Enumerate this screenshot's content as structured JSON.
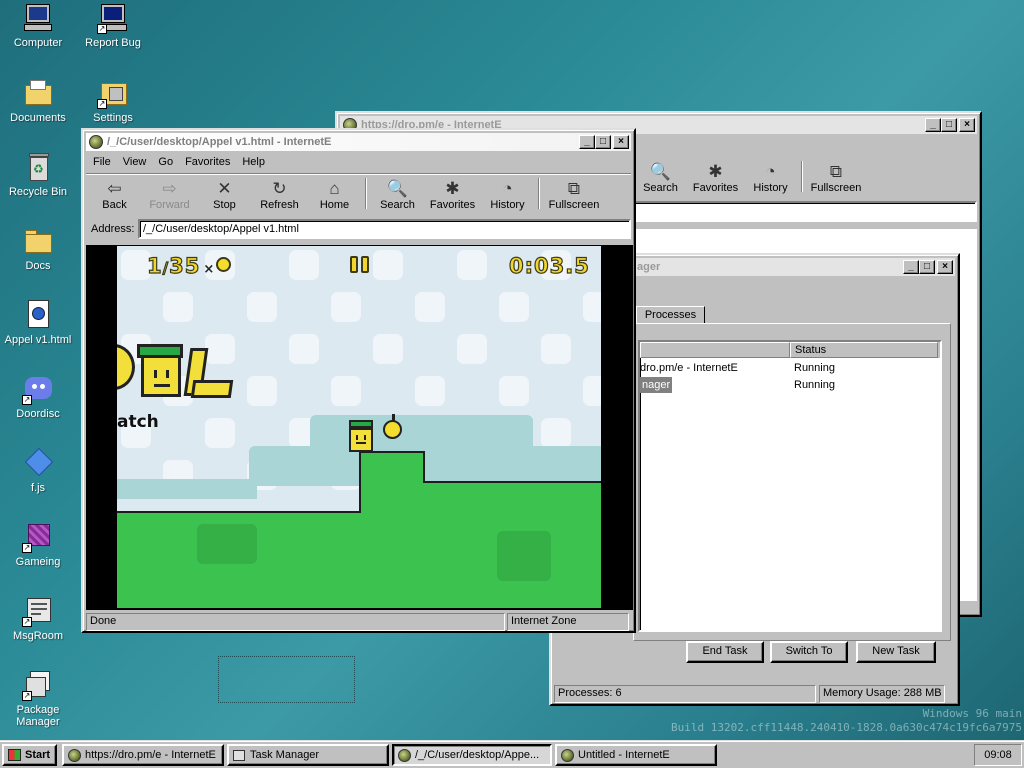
{
  "desktop": {
    "icons": [
      {
        "label": "Computer",
        "icon": "computer-icon"
      },
      {
        "label": "Report Bug",
        "icon": "report-bug-icon"
      },
      {
        "label": "Documents",
        "icon": "documents-folder-icon"
      },
      {
        "label": "Settings",
        "icon": "settings-icon"
      },
      {
        "label": "Recycle Bin",
        "icon": "recycle-bin-icon"
      },
      {
        "label": "Docs",
        "icon": "folder-icon"
      },
      {
        "label": "Appel v1.html",
        "icon": "html-file-icon"
      },
      {
        "label": "Doordisc",
        "icon": "doordisc-icon"
      },
      {
        "label": "f.js",
        "icon": "js-file-icon"
      },
      {
        "label": "Gameing",
        "icon": "gameing-icon"
      },
      {
        "label": "MsgRoom",
        "icon": "msgroom-icon"
      },
      {
        "label": "Package Manager",
        "icon": "package-manager-icon"
      }
    ],
    "watermark": {
      "line1": "Windows 96 main",
      "line2": "Build 13202.cff11448.240410-1828.0a630c474c19fc6a7975"
    }
  },
  "back_browser": {
    "title": "https://dro.pm/e - InternetE",
    "toolbar": [
      {
        "label": "Search",
        "glyph": "🔍"
      },
      {
        "label": "Favorites",
        "glyph": "✱"
      },
      {
        "label": "History",
        "glyph": "◔"
      },
      {
        "label": "Fullscreen",
        "glyph": "⧉"
      }
    ]
  },
  "task_manager": {
    "title_fragment": "ager",
    "tab": "Processes",
    "columns": [
      "",
      "Status"
    ],
    "rows": [
      {
        "name": "dro.pm/e - InternetE",
        "status": "Running"
      },
      {
        "name": "nager",
        "status": "Running"
      }
    ],
    "buttons": {
      "end_task": "End Task",
      "switch_to": "Switch To",
      "new_task": "New Task"
    },
    "status": {
      "processes": "Processes: 6",
      "memory": "Memory Usage: 288 MB"
    }
  },
  "main_browser": {
    "title": "/_/C/user/desktop/Appel v1.html - InternetE",
    "menu": [
      "File",
      "View",
      "Go",
      "Favorites",
      "Help"
    ],
    "toolbar": [
      {
        "label": "Back",
        "glyph": "⇦",
        "enabled": true
      },
      {
        "label": "Forward",
        "glyph": "⇨",
        "enabled": false
      },
      {
        "label": "Stop",
        "glyph": "✕",
        "enabled": true
      },
      {
        "label": "Refresh",
        "glyph": "↻",
        "enabled": true
      },
      {
        "label": "Home",
        "glyph": "⌂",
        "enabled": true
      },
      {
        "label": "Search",
        "glyph": "🔍",
        "enabled": true
      },
      {
        "label": "Favorites",
        "glyph": "✱",
        "enabled": true
      },
      {
        "label": "History",
        "glyph": "◔",
        "enabled": true
      },
      {
        "label": "Fullscreen",
        "glyph": "⧉",
        "enabled": true
      }
    ],
    "address_label": "Address:",
    "address": "/_/C/user/desktop/Appel v1.html",
    "status_left": "Done",
    "status_zone": "Internet Zone"
  },
  "game": {
    "apples_collected": "1",
    "apples_total": "35",
    "counter_sep": "/",
    "counter_x": "×",
    "timer": "0:03.5",
    "side_text": "atch",
    "colors": {
      "sky": "#dde9f1",
      "ground": "#3cc24f",
      "hill": "#a9d5d6",
      "player": "#f2df3a",
      "hat": "#27a844",
      "apple": "#f4dd2d"
    }
  },
  "taskbar": {
    "start": "Start",
    "tasks": [
      {
        "label": "https://dro.pm/e - InternetE",
        "pressed": false
      },
      {
        "label": "Task Manager",
        "pressed": false
      },
      {
        "label": "/_/C/user/desktop/Appe...",
        "pressed": true
      },
      {
        "label": "Untitled - InternetE",
        "pressed": false
      }
    ],
    "clock": "09:08"
  }
}
